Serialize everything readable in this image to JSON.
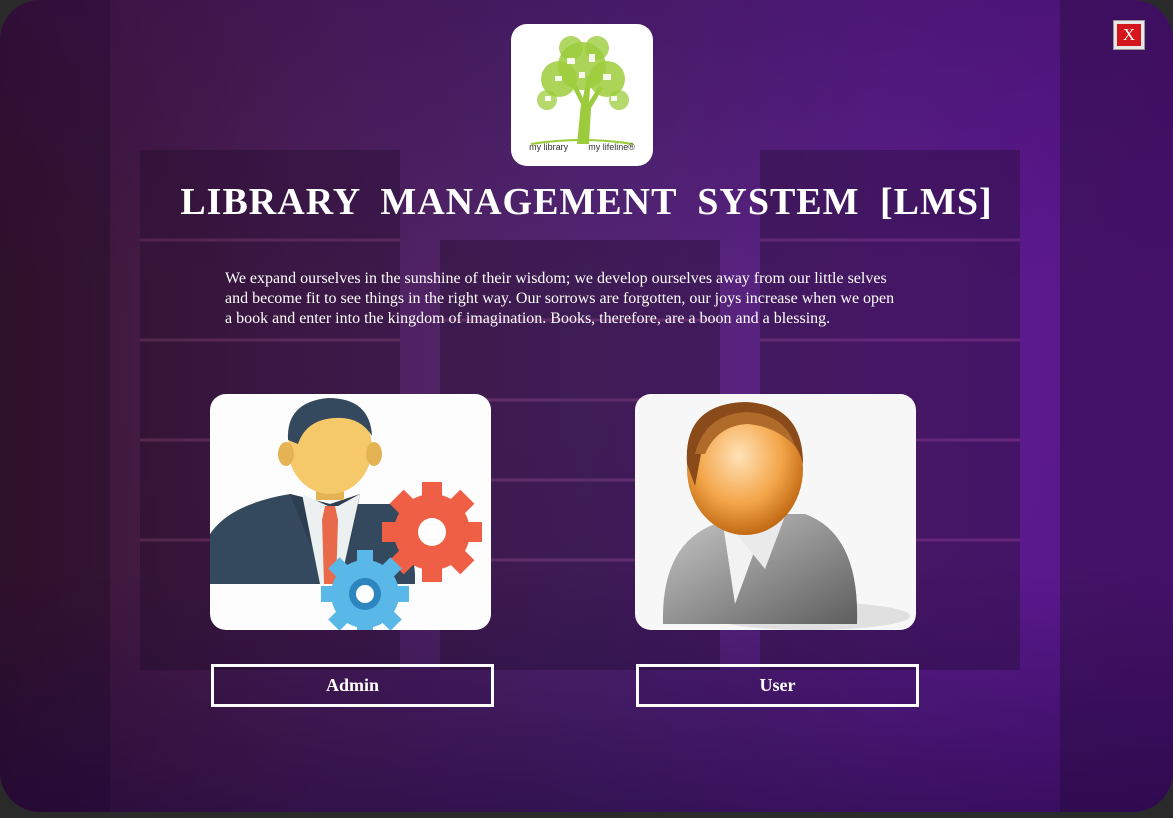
{
  "window": {
    "close_label": "X",
    "title": "LIBRARY  MANAGEMENT  SYSTEM [LMS]",
    "quote": "We expand ourselves in the sunshine of their wisdom; we develop ourselves away from our little selves and become fit to see things in the right way. Our sorrows are forgotten, our joys increase when we open a book and enter into the kingdom of imagination. Books, therefore, are a boon and a blessing."
  },
  "logo": {
    "text_left": "my library",
    "text_right": "my lifeline®",
    "tree_color": "#9ccc3c"
  },
  "roles": {
    "admin": {
      "label": "Admin",
      "icon": "admin-person-gears-icon"
    },
    "user": {
      "label": "User",
      "icon": "user-person-icon"
    }
  },
  "colors": {
    "close_red": "#d4161c",
    "gear_red": "#ee5f45",
    "gear_blue": "#5ab8e8",
    "suit": "#34495e",
    "skin": "#f5c86a"
  }
}
